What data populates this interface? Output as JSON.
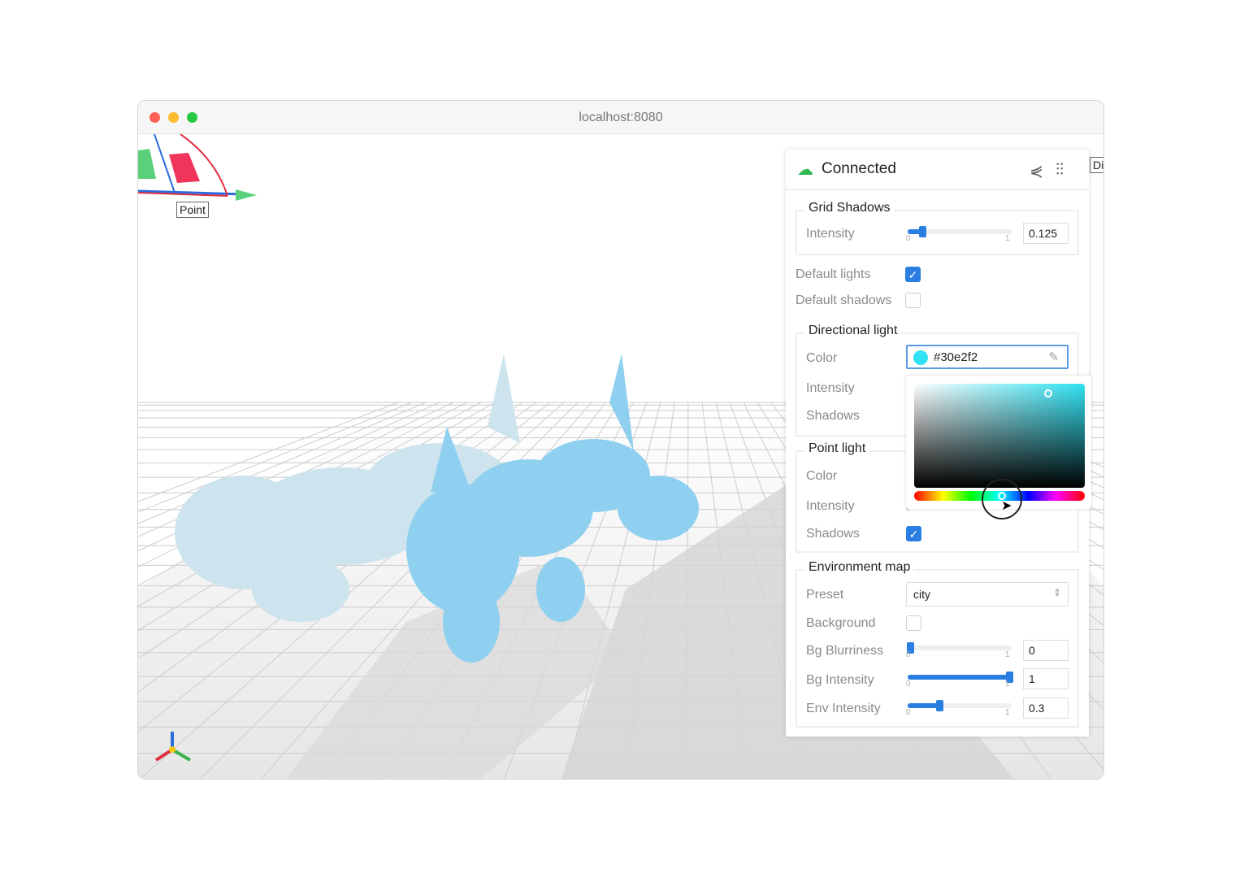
{
  "window": {
    "title": "localhost:8080"
  },
  "viewport": {
    "point_label": "Point",
    "dir_label": "Di"
  },
  "panel": {
    "status": "Connected",
    "share_icon": "share-icon",
    "settings_icon": "sliders-icon",
    "grid_shadows": {
      "title": "Grid Shadows",
      "intensity_label": "Intensity",
      "min": "0",
      "max": "1",
      "value": "0.125",
      "fraction": 0.125
    },
    "default_lights": {
      "label": "Default lights",
      "checked": true
    },
    "default_shadows": {
      "label": "Default shadows",
      "checked": false
    },
    "directional": {
      "title": "Directional light",
      "color_label": "Color",
      "color_value": "#30e2f2",
      "intensity_label": "Intensity",
      "shadows_label": "Shadows"
    },
    "point": {
      "title": "Point light",
      "color_label": "Color",
      "intensity_label": "Intensity",
      "intensity_min": "0",
      "shadows_label": "Shadows",
      "shadows_checked": true
    },
    "env": {
      "title": "Environment map",
      "preset_label": "Preset",
      "preset_value": "city",
      "background_label": "Background",
      "blur_label": "Bg Blurriness",
      "blur_value": "0",
      "bgint_label": "Bg Intensity",
      "bgint_value": "1",
      "envint_label": "Env Intensity",
      "envint_value": "0.3",
      "min": "0",
      "max": "1"
    }
  },
  "colors": {
    "accent": "#2a7de1",
    "picked": "#30e2f2",
    "connected": "#2db84d"
  }
}
